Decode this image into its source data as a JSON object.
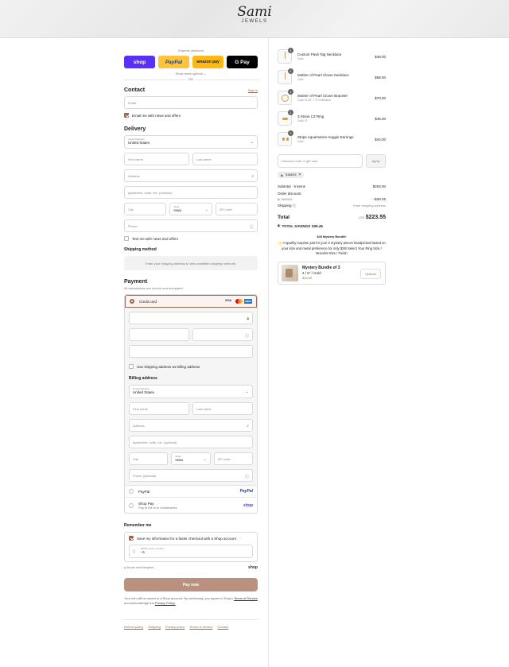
{
  "brand": {
    "name": "Sami",
    "sub": "JEWELS"
  },
  "express": {
    "label": "Express checkout",
    "buttons": [
      {
        "label": "shop",
        "bg": "#5a31f4",
        "fg": "#ffffff"
      },
      {
        "label": "PayPal",
        "bg": "#ffc439",
        "fg": "#253b80"
      },
      {
        "label": "amazon pay",
        "bg": "#ffb814",
        "fg": "#222222"
      },
      {
        "label": "G Pay",
        "bg": "#000000",
        "fg": "#ffffff"
      }
    ],
    "more": "Show more options",
    "or": "OR"
  },
  "contact": {
    "title": "Contact",
    "signin": "Sign in",
    "email_placeholder": "Email",
    "news": "Email me with news and offers"
  },
  "delivery": {
    "title": "Delivery",
    "country_label": "Country/Region",
    "country": "United States",
    "first": "First name",
    "last": "Last name",
    "address": "Address",
    "apt": "Apartment, suite, etc. (optional)",
    "city": "City",
    "state_label": "State",
    "state": "Iowa",
    "zip": "ZIP code",
    "phone": "Phone",
    "text_news": "Text me with news and offers"
  },
  "shipping": {
    "title": "Shipping method",
    "note": "Enter your shipping address to view available shipping methods."
  },
  "payment": {
    "title": "Payment",
    "secure": "All transactions are secure and encrypted.",
    "credit": "Credit card",
    "card_brands": [
      "VISA",
      "MC",
      "AMEX"
    ],
    "use_shipping": "Use shipping address as billing address",
    "paypal": "PayPal",
    "shoppay": "Shop Pay",
    "shoppay_sub": "Pay in full or in installments",
    "shop_logo": "shop"
  },
  "billing": {
    "title": "Billing address",
    "country_label": "Country/Region",
    "country": "United States",
    "first": "First name",
    "last": "Last name",
    "address": "Address",
    "apt": "Apartment, suite, etc. (optional)",
    "city": "City",
    "state_label": "State",
    "state": "Iowa",
    "zip": "ZIP code",
    "phone": "Phone (optional)"
  },
  "remember": {
    "title": "Remember me",
    "save": "Save my information for a faster checkout with a Shop account",
    "mobile_label": "Mobile phone number",
    "mobile": "+1",
    "secure": "Secure and encrypted",
    "shop": "shop"
  },
  "paynow": "Pay now",
  "legal": {
    "pre": "Your info will be saved to a Shop account. By continuing, you agree to Shop's",
    "tos": "Terms of Service",
    "mid": "and acknowledge the",
    "privacy": "Privacy Policy."
  },
  "footer": [
    "Refund policy",
    "Shipping",
    "Privacy policy",
    "Terms of service",
    "Contact"
  ],
  "order": {
    "items": [
      {
        "qty": "1",
        "name": "Custom Pavé Tag Necklace",
        "variant": "Gold",
        "price": "$48.00"
      },
      {
        "qty": "1",
        "name": "Mother of Pearl Clover Necklace",
        "variant": "Gold",
        "price": "$58.00"
      },
      {
        "qty": "1",
        "name": "Mother of Pearl Clover Bracelet",
        "variant": "Gold / 6.25\" + 3\" Extension",
        "price": "$70.00"
      },
      {
        "qty": "1",
        "name": "3 Stone CZ Ring",
        "variant": "Gold / 6",
        "price": "$45.00"
      },
      {
        "qty": "1",
        "name": "Stripe Aquamarine Huggie Earrings",
        "variant": "Gold",
        "price": "$44.00"
      }
    ],
    "discount_placeholder": "Discount code or gift card",
    "apply": "Apply",
    "code": "SAMI15",
    "subtotal_label": "Subtotal · 5 items",
    "subtotal": "$263.00",
    "order_discount": "Order discount",
    "discount_code": "SAMI15",
    "discount_amount": "−$39.45",
    "shipping_label": "Shipping",
    "shipping_value": "Enter shipping address",
    "total_label": "Total",
    "currency": "USD",
    "total": "$223.55",
    "savings_label": "TOTAL SAVINGS",
    "savings": "$39.45",
    "promo_title": "$28 Mystery Bundle!",
    "promo_text": "✨ A sparkly surprise just for you! 3 mystery pieces handpicked based on your size and metal preference for only $28! Select Your Ring Size / Bracelet Size / Finish",
    "bundle_name": "Mystery Bundle of 3",
    "bundle_variant": "4 / 6\" / Gold",
    "bundle_price": "$28.00",
    "options": "Options"
  },
  "colors": {
    "accent": "#9c6a52",
    "paynow": "#b9917e"
  }
}
